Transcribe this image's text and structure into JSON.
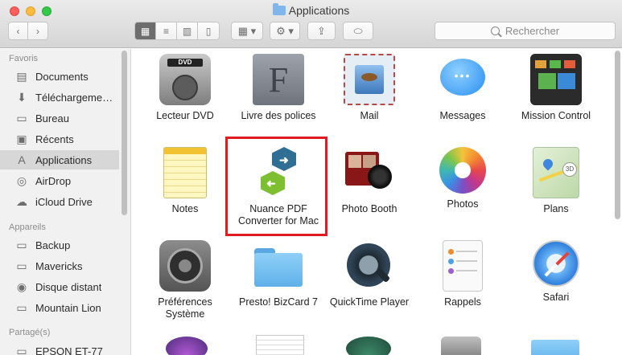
{
  "window": {
    "title": "Applications"
  },
  "toolbar": {
    "back_icon": "chevron-left-icon",
    "forward_icon": "chevron-right-icon",
    "view_buttons": [
      "icon-view-icon",
      "list-view-icon",
      "column-view-icon",
      "cover-flow-icon"
    ],
    "arrange_icon": "arrange-icon",
    "action_icon": "gear-icon",
    "share_icon": "share-icon",
    "tag_icon": "tag-icon",
    "search_placeholder": "Rechercher"
  },
  "sidebar": {
    "favoris_header": "Favoris",
    "favoris": [
      {
        "label": "Documents",
        "icon": "documents-icon"
      },
      {
        "label": "Téléchargeme…",
        "icon": "downloads-icon"
      },
      {
        "label": "Bureau",
        "icon": "desktop-icon"
      },
      {
        "label": "Récents",
        "icon": "recents-icon"
      },
      {
        "label": "Applications",
        "icon": "applications-icon",
        "selected": true
      },
      {
        "label": "AirDrop",
        "icon": "airdrop-icon"
      },
      {
        "label": "iCloud Drive",
        "icon": "icloud-icon"
      }
    ],
    "appareils_header": "Appareils",
    "appareils": [
      {
        "label": "Backup",
        "icon": "disk-icon"
      },
      {
        "label": "Mavericks",
        "icon": "disk-icon"
      },
      {
        "label": "Disque distant",
        "icon": "optical-disk-icon"
      },
      {
        "label": "Mountain Lion",
        "icon": "disk-icon"
      }
    ],
    "partages_header": "Partagé(s)",
    "partages": [
      {
        "label": "EPSON ET-77",
        "icon": "network-icon"
      }
    ]
  },
  "apps": [
    {
      "label": "Lecteur DVD",
      "color": "#9a9a9a"
    },
    {
      "label": "Livre des polices",
      "color": "#8a8f98"
    },
    {
      "label": "Mail",
      "color": "#d7e7f6"
    },
    {
      "label": "Messages",
      "color": "#3ba4f7"
    },
    {
      "label": "Mission Control",
      "color": "#2b2b2b"
    },
    {
      "label": "Notes",
      "color": "#fdea86"
    },
    {
      "label": "Nuance PDF Converter for Mac",
      "label_line1": "Nuance PDF",
      "label_line2": "Converter for Mac",
      "color": "#2f6f94"
    },
    {
      "label": "Photo Booth",
      "color": "#9b1c1c"
    },
    {
      "label": "Photos",
      "color": "#ffffff"
    },
    {
      "label": "Plans",
      "color": "#cfe3c0"
    },
    {
      "label": "Préférences Système",
      "label_line1": "Préférences",
      "label_line2": "Système",
      "color": "#7d7d7d"
    },
    {
      "label": "Presto! BizCard 7",
      "color": "#6cb9ec"
    },
    {
      "label": "QuickTime Player",
      "color": "#2a3a48"
    },
    {
      "label": "Rappels",
      "color": "#f4f4f4"
    },
    {
      "label": "Safari",
      "color": "#3e95ea"
    }
  ],
  "colors": {
    "selection_highlight": "#e11b22",
    "sidebar_bg": "#f2f1f2",
    "selected_item_bg": "#d8d7d8"
  }
}
